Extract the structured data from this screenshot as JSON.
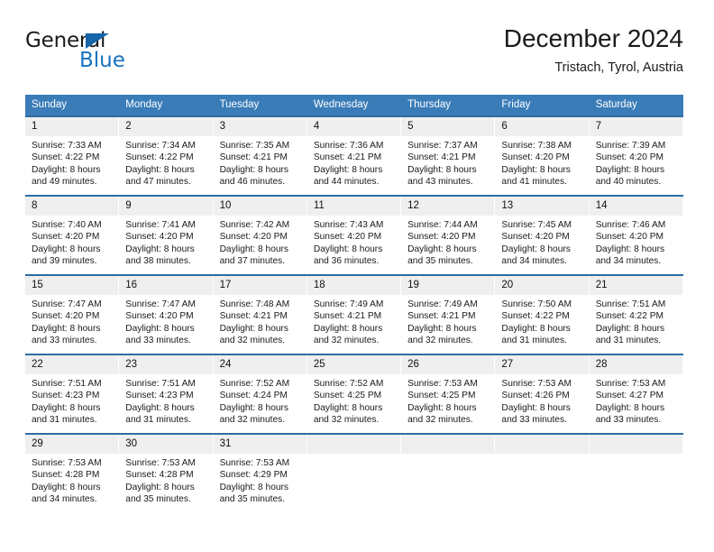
{
  "brand": {
    "name_part1": "General",
    "name_part2": "Blue"
  },
  "header": {
    "title": "December 2024",
    "location": "Tristach, Tyrol, Austria"
  },
  "calendar": {
    "weekday_headers": [
      "Sunday",
      "Monday",
      "Tuesday",
      "Wednesday",
      "Thursday",
      "Friday",
      "Saturday"
    ],
    "accent_color": "#3A7CB8",
    "row_border_color": "#2E6DA4",
    "daynum_background": "#efefef",
    "weeks": [
      [
        {
          "day": "1",
          "sunrise": "Sunrise: 7:33 AM",
          "sunset": "Sunset: 4:22 PM",
          "daylight1": "Daylight: 8 hours",
          "daylight2": "and 49 minutes."
        },
        {
          "day": "2",
          "sunrise": "Sunrise: 7:34 AM",
          "sunset": "Sunset: 4:22 PM",
          "daylight1": "Daylight: 8 hours",
          "daylight2": "and 47 minutes."
        },
        {
          "day": "3",
          "sunrise": "Sunrise: 7:35 AM",
          "sunset": "Sunset: 4:21 PM",
          "daylight1": "Daylight: 8 hours",
          "daylight2": "and 46 minutes."
        },
        {
          "day": "4",
          "sunrise": "Sunrise: 7:36 AM",
          "sunset": "Sunset: 4:21 PM",
          "daylight1": "Daylight: 8 hours",
          "daylight2": "and 44 minutes."
        },
        {
          "day": "5",
          "sunrise": "Sunrise: 7:37 AM",
          "sunset": "Sunset: 4:21 PM",
          "daylight1": "Daylight: 8 hours",
          "daylight2": "and 43 minutes."
        },
        {
          "day": "6",
          "sunrise": "Sunrise: 7:38 AM",
          "sunset": "Sunset: 4:20 PM",
          "daylight1": "Daylight: 8 hours",
          "daylight2": "and 41 minutes."
        },
        {
          "day": "7",
          "sunrise": "Sunrise: 7:39 AM",
          "sunset": "Sunset: 4:20 PM",
          "daylight1": "Daylight: 8 hours",
          "daylight2": "and 40 minutes."
        }
      ],
      [
        {
          "day": "8",
          "sunrise": "Sunrise: 7:40 AM",
          "sunset": "Sunset: 4:20 PM",
          "daylight1": "Daylight: 8 hours",
          "daylight2": "and 39 minutes."
        },
        {
          "day": "9",
          "sunrise": "Sunrise: 7:41 AM",
          "sunset": "Sunset: 4:20 PM",
          "daylight1": "Daylight: 8 hours",
          "daylight2": "and 38 minutes."
        },
        {
          "day": "10",
          "sunrise": "Sunrise: 7:42 AM",
          "sunset": "Sunset: 4:20 PM",
          "daylight1": "Daylight: 8 hours",
          "daylight2": "and 37 minutes."
        },
        {
          "day": "11",
          "sunrise": "Sunrise: 7:43 AM",
          "sunset": "Sunset: 4:20 PM",
          "daylight1": "Daylight: 8 hours",
          "daylight2": "and 36 minutes."
        },
        {
          "day": "12",
          "sunrise": "Sunrise: 7:44 AM",
          "sunset": "Sunset: 4:20 PM",
          "daylight1": "Daylight: 8 hours",
          "daylight2": "and 35 minutes."
        },
        {
          "day": "13",
          "sunrise": "Sunrise: 7:45 AM",
          "sunset": "Sunset: 4:20 PM",
          "daylight1": "Daylight: 8 hours",
          "daylight2": "and 34 minutes."
        },
        {
          "day": "14",
          "sunrise": "Sunrise: 7:46 AM",
          "sunset": "Sunset: 4:20 PM",
          "daylight1": "Daylight: 8 hours",
          "daylight2": "and 34 minutes."
        }
      ],
      [
        {
          "day": "15",
          "sunrise": "Sunrise: 7:47 AM",
          "sunset": "Sunset: 4:20 PM",
          "daylight1": "Daylight: 8 hours",
          "daylight2": "and 33 minutes."
        },
        {
          "day": "16",
          "sunrise": "Sunrise: 7:47 AM",
          "sunset": "Sunset: 4:20 PM",
          "daylight1": "Daylight: 8 hours",
          "daylight2": "and 33 minutes."
        },
        {
          "day": "17",
          "sunrise": "Sunrise: 7:48 AM",
          "sunset": "Sunset: 4:21 PM",
          "daylight1": "Daylight: 8 hours",
          "daylight2": "and 32 minutes."
        },
        {
          "day": "18",
          "sunrise": "Sunrise: 7:49 AM",
          "sunset": "Sunset: 4:21 PM",
          "daylight1": "Daylight: 8 hours",
          "daylight2": "and 32 minutes."
        },
        {
          "day": "19",
          "sunrise": "Sunrise: 7:49 AM",
          "sunset": "Sunset: 4:21 PM",
          "daylight1": "Daylight: 8 hours",
          "daylight2": "and 32 minutes."
        },
        {
          "day": "20",
          "sunrise": "Sunrise: 7:50 AM",
          "sunset": "Sunset: 4:22 PM",
          "daylight1": "Daylight: 8 hours",
          "daylight2": "and 31 minutes."
        },
        {
          "day": "21",
          "sunrise": "Sunrise: 7:51 AM",
          "sunset": "Sunset: 4:22 PM",
          "daylight1": "Daylight: 8 hours",
          "daylight2": "and 31 minutes."
        }
      ],
      [
        {
          "day": "22",
          "sunrise": "Sunrise: 7:51 AM",
          "sunset": "Sunset: 4:23 PM",
          "daylight1": "Daylight: 8 hours",
          "daylight2": "and 31 minutes."
        },
        {
          "day": "23",
          "sunrise": "Sunrise: 7:51 AM",
          "sunset": "Sunset: 4:23 PM",
          "daylight1": "Daylight: 8 hours",
          "daylight2": "and 31 minutes."
        },
        {
          "day": "24",
          "sunrise": "Sunrise: 7:52 AM",
          "sunset": "Sunset: 4:24 PM",
          "daylight1": "Daylight: 8 hours",
          "daylight2": "and 32 minutes."
        },
        {
          "day": "25",
          "sunrise": "Sunrise: 7:52 AM",
          "sunset": "Sunset: 4:25 PM",
          "daylight1": "Daylight: 8 hours",
          "daylight2": "and 32 minutes."
        },
        {
          "day": "26",
          "sunrise": "Sunrise: 7:53 AM",
          "sunset": "Sunset: 4:25 PM",
          "daylight1": "Daylight: 8 hours",
          "daylight2": "and 32 minutes."
        },
        {
          "day": "27",
          "sunrise": "Sunrise: 7:53 AM",
          "sunset": "Sunset: 4:26 PM",
          "daylight1": "Daylight: 8 hours",
          "daylight2": "and 33 minutes."
        },
        {
          "day": "28",
          "sunrise": "Sunrise: 7:53 AM",
          "sunset": "Sunset: 4:27 PM",
          "daylight1": "Daylight: 8 hours",
          "daylight2": "and 33 minutes."
        }
      ],
      [
        {
          "day": "29",
          "sunrise": "Sunrise: 7:53 AM",
          "sunset": "Sunset: 4:28 PM",
          "daylight1": "Daylight: 8 hours",
          "daylight2": "and 34 minutes."
        },
        {
          "day": "30",
          "sunrise": "Sunrise: 7:53 AM",
          "sunset": "Sunset: 4:28 PM",
          "daylight1": "Daylight: 8 hours",
          "daylight2": "and 35 minutes."
        },
        {
          "day": "31",
          "sunrise": "Sunrise: 7:53 AM",
          "sunset": "Sunset: 4:29 PM",
          "daylight1": "Daylight: 8 hours",
          "daylight2": "and 35 minutes."
        },
        {
          "day": "",
          "sunrise": "",
          "sunset": "",
          "daylight1": "",
          "daylight2": ""
        },
        {
          "day": "",
          "sunrise": "",
          "sunset": "",
          "daylight1": "",
          "daylight2": ""
        },
        {
          "day": "",
          "sunrise": "",
          "sunset": "",
          "daylight1": "",
          "daylight2": ""
        },
        {
          "day": "",
          "sunrise": "",
          "sunset": "",
          "daylight1": "",
          "daylight2": ""
        }
      ]
    ]
  }
}
